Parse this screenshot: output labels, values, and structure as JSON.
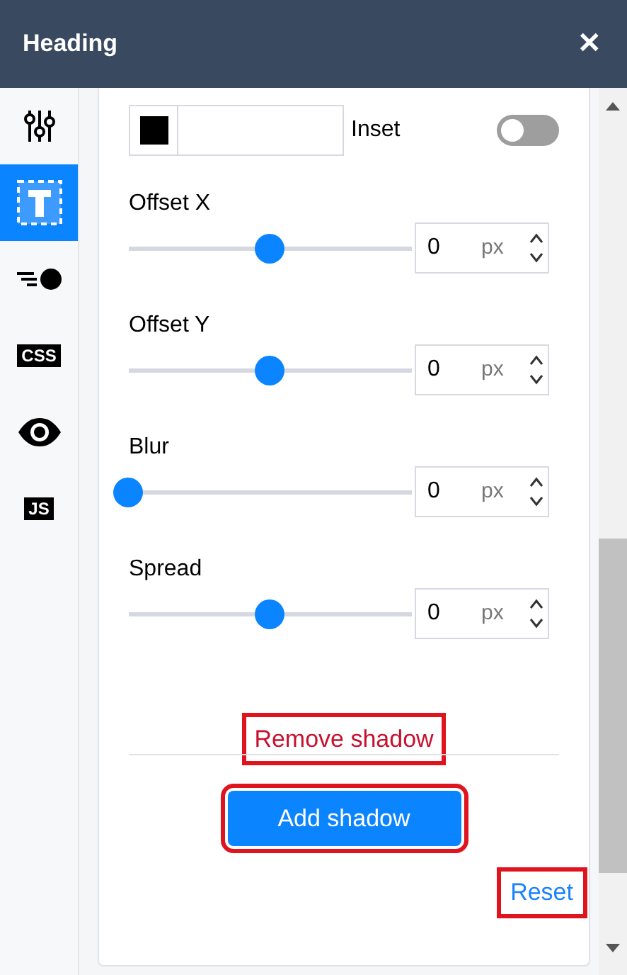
{
  "header": {
    "title": "Heading",
    "close": "✕"
  },
  "rail": [
    {
      "kind": "sliders",
      "selected": false
    },
    {
      "kind": "text",
      "selected": true
    },
    {
      "kind": "shadow",
      "selected": false
    },
    {
      "kind": "css",
      "label": "CSS",
      "selected": false
    },
    {
      "kind": "eye",
      "selected": false
    },
    {
      "kind": "js",
      "label": "JS",
      "selected": false
    }
  ],
  "inset": {
    "label": "Inset",
    "on": false
  },
  "controls": [
    {
      "label": "Offset X",
      "level": 0.5,
      "value": "0",
      "unit": "px"
    },
    {
      "label": "Offset Y",
      "level": 0.5,
      "value": "0",
      "unit": "px"
    },
    {
      "label": "Blur",
      "level": 0,
      "value": "0",
      "unit": "px"
    },
    {
      "label": "Spread",
      "level": 0.5,
      "value": "0",
      "unit": "px"
    }
  ],
  "remove_button": {
    "label": "Remove shadow",
    "highlighted": true
  },
  "add_button": {
    "label": "Add shadow",
    "highlighted": true
  },
  "reset_link": {
    "label": "Reset",
    "highlighted": true
  }
}
